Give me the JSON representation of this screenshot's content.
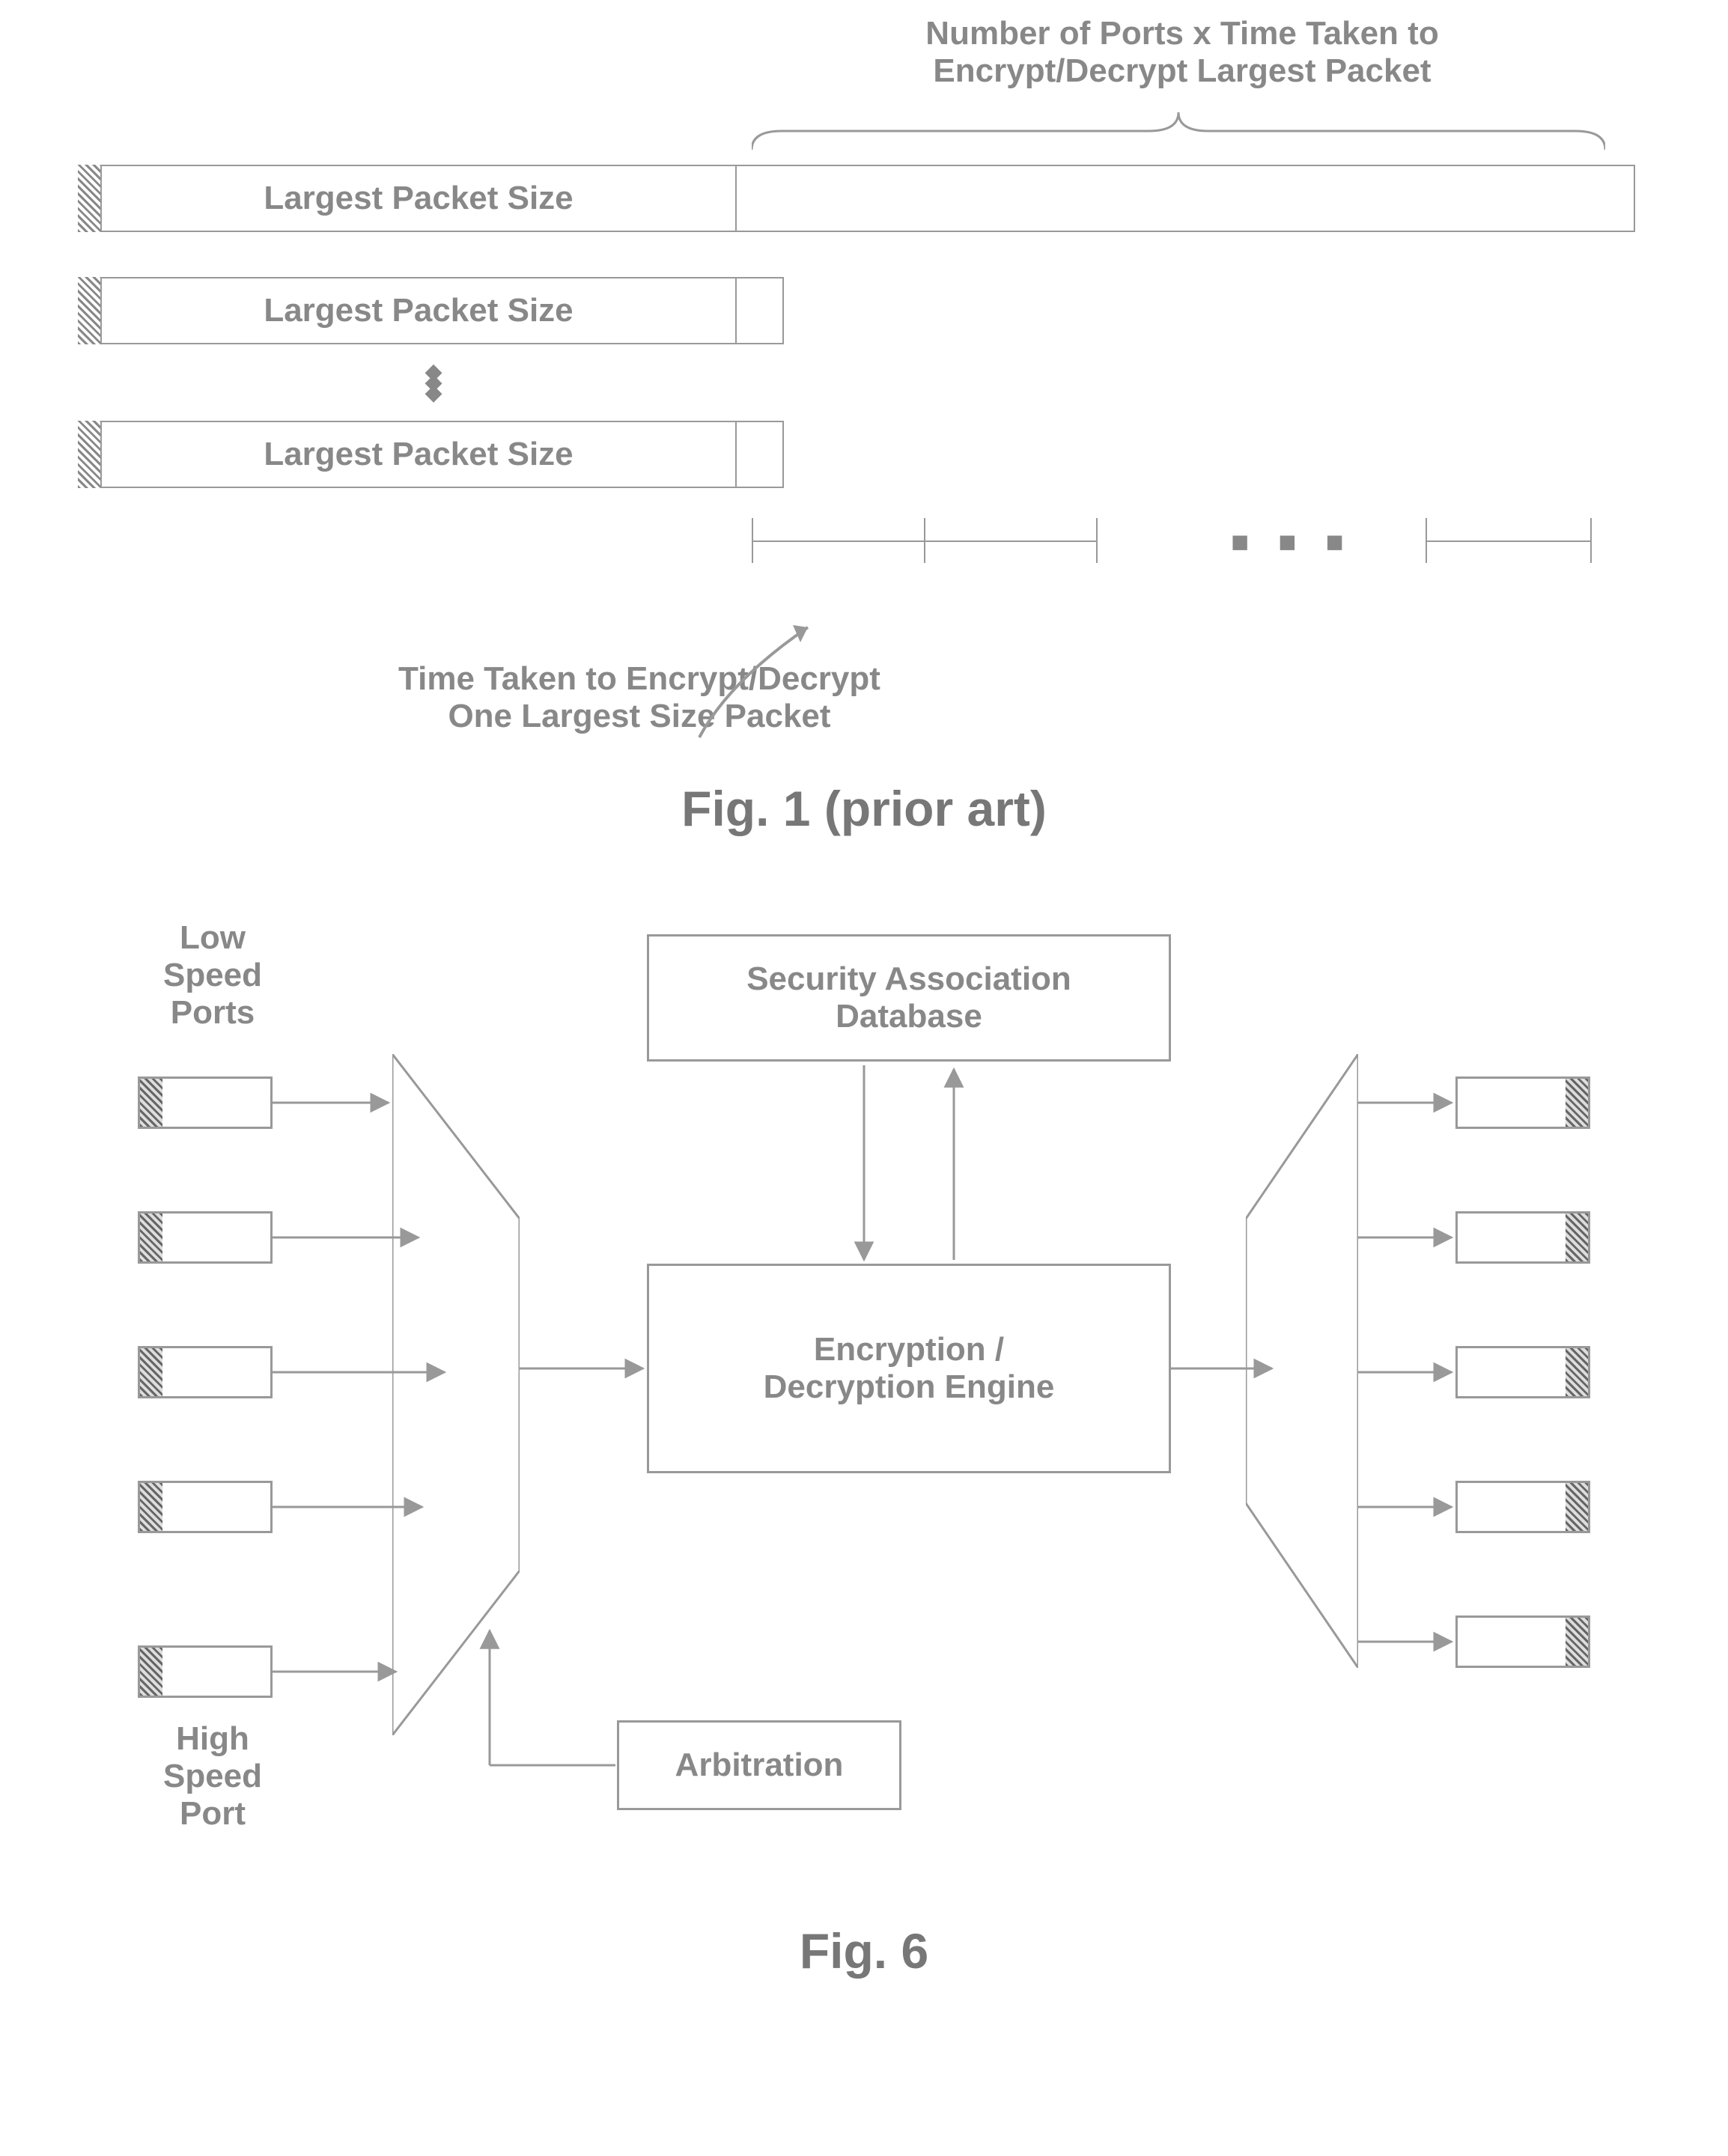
{
  "fig1": {
    "top_annotation_line1": "Number of Ports x Time Taken to",
    "top_annotation_line2": "Encrypt/Decrypt Largest Packet",
    "bar_label": "Largest Packet Size",
    "bottom_annotation_line1": "Time Taken to Encrypt/Decrypt",
    "bottom_annotation_line2": "One Largest Size Packet",
    "caption": "Fig. 1 (prior art)"
  },
  "fig6": {
    "low_speed_label": "Low\nSpeed\nPorts",
    "high_speed_label": "High\nSpeed\nPort",
    "sad_label": "Security Association\nDatabase",
    "engine_label": "Encryption /\nDecryption Engine",
    "arbitration_label": "Arbitration",
    "caption": "Fig. 6"
  }
}
